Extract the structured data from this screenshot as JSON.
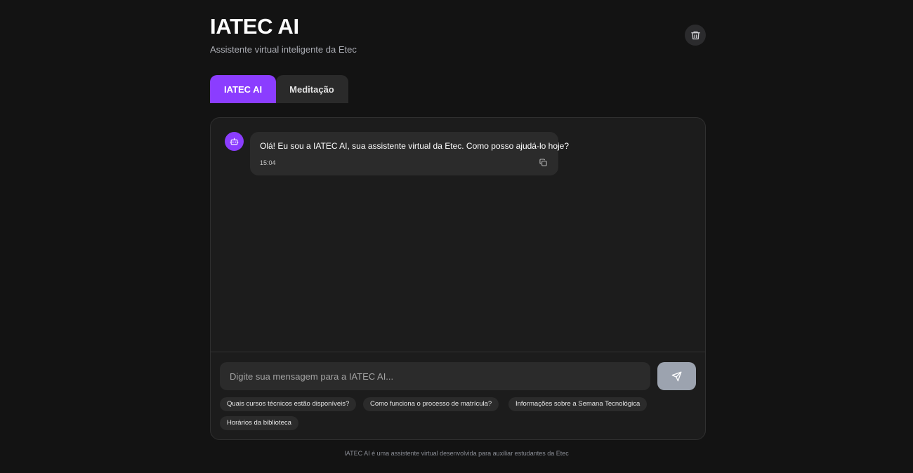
{
  "header": {
    "title": "IATEC AI",
    "subtitle": "Assistente virtual inteligente da Etec",
    "clear_icon": "trash-icon"
  },
  "tabs": [
    {
      "label": "IATEC AI",
      "active": true
    },
    {
      "label": "Meditação",
      "active": false
    }
  ],
  "chat": {
    "messages": [
      {
        "sender": "bot",
        "avatar_icon": "robot-icon",
        "text": "Olá! Eu sou a IATEC AI, sua assistente virtual da Etec. Como posso ajudá-lo hoje?",
        "time": "15:04",
        "action_icon": "copy-icon"
      }
    ]
  },
  "composer": {
    "placeholder": "Digite sua mensagem para a IATEC AI...",
    "send_icon": "send-icon",
    "suggestions": [
      "Quais cursos técnicos estão disponíveis?",
      "Como funciona o processo de matrícula?",
      "Informações sobre a Semana Tecnológica",
      "Horários da biblioteca"
    ]
  },
  "footer": {
    "text": "IATEC AI é uma assistente virtual desenvolvida para auxiliar estudantes da Etec"
  },
  "colors": {
    "accent": "#8b3dff",
    "background": "#131313",
    "card": "#1c1c1c",
    "send_button": "#9ca3af"
  }
}
